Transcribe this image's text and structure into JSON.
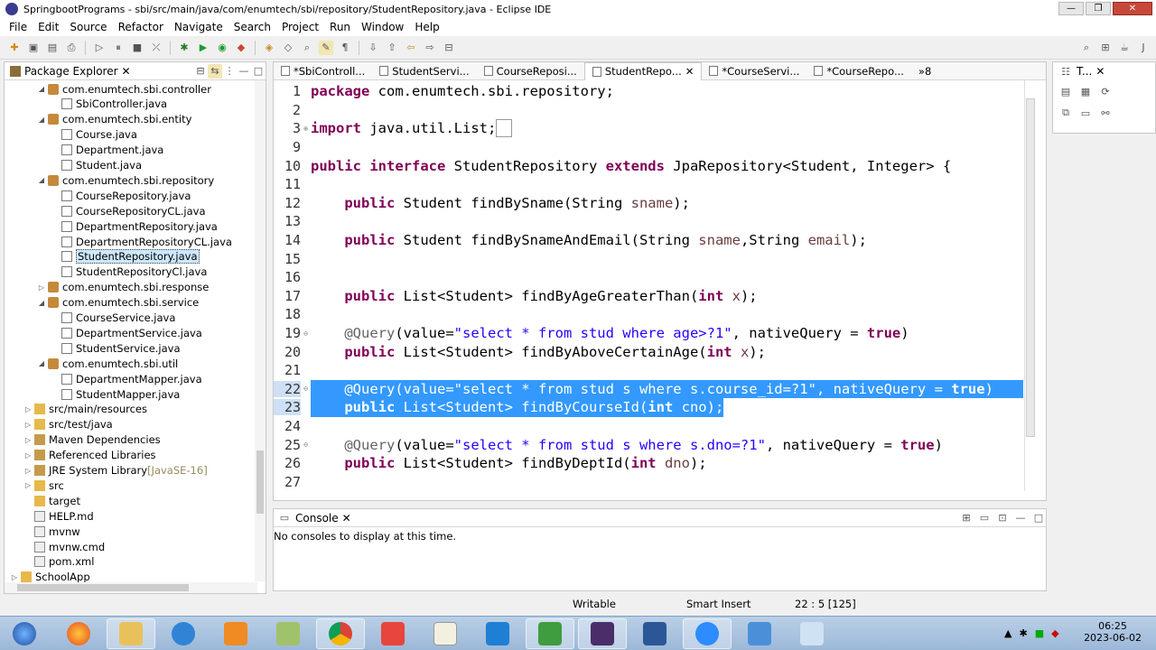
{
  "window": {
    "title": "SpringbootPrograms - sbi/src/main/java/com/enumtech/sbi/repository/StudentRepository.java - Eclipse IDE"
  },
  "menu": [
    "File",
    "Edit",
    "Source",
    "Refactor",
    "Navigate",
    "Search",
    "Project",
    "Run",
    "Window",
    "Help"
  ],
  "package_explorer": {
    "title": "Package Explorer",
    "items": [
      {
        "label": "com.enumtech.sbi.controller",
        "depth": 2,
        "type": "package",
        "expanded": true
      },
      {
        "label": "SbiController.java",
        "depth": 3,
        "type": "java"
      },
      {
        "label": "com.enumtech.sbi.entity",
        "depth": 2,
        "type": "package",
        "expanded": true
      },
      {
        "label": "Course.java",
        "depth": 3,
        "type": "java"
      },
      {
        "label": "Department.java",
        "depth": 3,
        "type": "java"
      },
      {
        "label": "Student.java",
        "depth": 3,
        "type": "java"
      },
      {
        "label": "com.enumtech.sbi.repository",
        "depth": 2,
        "type": "package",
        "expanded": true
      },
      {
        "label": "CourseRepository.java",
        "depth": 3,
        "type": "java"
      },
      {
        "label": "CourseRepositoryCL.java",
        "depth": 3,
        "type": "java"
      },
      {
        "label": "DepartmentRepository.java",
        "depth": 3,
        "type": "java"
      },
      {
        "label": "DepartmentRepositoryCL.java",
        "depth": 3,
        "type": "java"
      },
      {
        "label": "StudentRepository.java",
        "depth": 3,
        "type": "java",
        "selected": true
      },
      {
        "label": "StudentRepositoryCl.java",
        "depth": 3,
        "type": "java"
      },
      {
        "label": "com.enumtech.sbi.response",
        "depth": 2,
        "type": "package",
        "expanded": false
      },
      {
        "label": "com.enumtech.sbi.service",
        "depth": 2,
        "type": "package",
        "expanded": true
      },
      {
        "label": "CourseService.java",
        "depth": 3,
        "type": "java"
      },
      {
        "label": "DepartmentService.java",
        "depth": 3,
        "type": "java"
      },
      {
        "label": "StudentService.java",
        "depth": 3,
        "type": "java"
      },
      {
        "label": "com.enumtech.sbi.util",
        "depth": 2,
        "type": "package",
        "expanded": true
      },
      {
        "label": "DepartmentMapper.java",
        "depth": 3,
        "type": "java"
      },
      {
        "label": "StudentMapper.java",
        "depth": 3,
        "type": "java"
      },
      {
        "label": "src/main/resources",
        "depth": 1,
        "type": "folder",
        "expanded": false
      },
      {
        "label": "src/test/java",
        "depth": 1,
        "type": "folder",
        "expanded": false
      },
      {
        "label": "Maven Dependencies",
        "depth": 1,
        "type": "jar",
        "expanded": false
      },
      {
        "label": "Referenced Libraries",
        "depth": 1,
        "type": "jar",
        "expanded": false
      },
      {
        "label": "JRE System Library",
        "suffix": "[JavaSE-16]",
        "depth": 1,
        "type": "jar",
        "expanded": false
      },
      {
        "label": "src",
        "depth": 1,
        "type": "folder",
        "expanded": false
      },
      {
        "label": "target",
        "depth": 1,
        "type": "folder"
      },
      {
        "label": "HELP.md",
        "depth": 1,
        "type": "file"
      },
      {
        "label": "mvnw",
        "depth": 1,
        "type": "file"
      },
      {
        "label": "mvnw.cmd",
        "depth": 1,
        "type": "file"
      },
      {
        "label": "pom.xml",
        "depth": 1,
        "type": "file"
      },
      {
        "label": "SchoolApp",
        "depth": 0,
        "type": "project",
        "expanded": false
      }
    ]
  },
  "editor_tabs": [
    {
      "label": "*SbiControll..."
    },
    {
      "label": "StudentServi..."
    },
    {
      "label": "CourseReposi..."
    },
    {
      "label": "StudentRepo...",
      "active": true
    },
    {
      "label": "*CourseServi..."
    },
    {
      "label": "*CourseRepo..."
    },
    {
      "label": "»8"
    }
  ],
  "code_lines": [
    {
      "n": "1",
      "html": "<span class=\"kw\">package</span> com.enumtech.sbi.repository;"
    },
    {
      "n": "2",
      "html": ""
    },
    {
      "n": "3",
      "fold": "⊕",
      "html": "<span class=\"kw\">import</span> java.util.List;<span style=\"border:1px solid #999;padding:0 3px\">&nbsp;</span>"
    },
    {
      "n": "9",
      "html": ""
    },
    {
      "n": "10",
      "html": "<span class=\"kw\">public interface</span> StudentRepository <span class=\"kw\">extends</span> JpaRepository&lt;Student, Integer&gt; {"
    },
    {
      "n": "11",
      "html": ""
    },
    {
      "n": "12",
      "html": "    <span class=\"kw\">public</span> Student findBySname(String <span class=\"var\">sname</span>);"
    },
    {
      "n": "13",
      "html": ""
    },
    {
      "n": "14",
      "html": "    <span class=\"kw\">public</span> Student findBySnameAndEmail(String <span class=\"var\">sname</span>,String <span class=\"var\">email</span>);"
    },
    {
      "n": "15",
      "html": ""
    },
    {
      "n": "16",
      "html": ""
    },
    {
      "n": "17",
      "html": "    <span class=\"kw\">public</span> List&lt;Student&gt; findByAgeGreaterThan(<span class=\"kw\">int</span> <span class=\"var\">x</span>);"
    },
    {
      "n": "18",
      "html": ""
    },
    {
      "n": "19",
      "fold": "⊖",
      "html": "    <span class=\"ann\">@Query</span>(value=<span class=\"str\">\"select * from stud where age&gt;?1\"</span>, nativeQuery = <span class=\"kw\">true</span>)"
    },
    {
      "n": "20",
      "html": "    <span class=\"kw\">public</span> List&lt;Student&gt; findByAboveCertainAge(<span class=\"kw\">int</span> <span class=\"var\">x</span>);"
    },
    {
      "n": "21",
      "html": ""
    },
    {
      "n": "22",
      "fold": "⊖",
      "sel": "full",
      "html": "    <span class=\"ann\">@Query</span>(value=<span class=\"str\">\"select * from stud s where s.course_id=?1\"</span>, nativeQuery = <span class=\"kw\">true</span>)"
    },
    {
      "n": "23",
      "sel": "partial",
      "html": "    <span class=\"kw\">public</span> List&lt;Student&gt; findByCourseId(<span class=\"kw\">int</span> <span class=\"var\">cno</span>);"
    },
    {
      "n": "24",
      "html": ""
    },
    {
      "n": "25",
      "fold": "⊖",
      "html": "    <span class=\"ann\">@Query</span>(value=<span class=\"str\">\"select * from stud s where s.dno=?1\"</span>, nativeQuery = <span class=\"kw\">true</span>)"
    },
    {
      "n": "26",
      "html": "    <span class=\"kw\">public</span> List&lt;Student&gt; findByDeptId(<span class=\"kw\">int</span> <span class=\"var\">dno</span>);"
    },
    {
      "n": "27",
      "html": ""
    }
  ],
  "side_view": {
    "title": "T..."
  },
  "console": {
    "title": "Console",
    "message": "No consoles to display at this time."
  },
  "status": {
    "writable": "Writable",
    "insert_mode": "Smart Insert",
    "position": "22 : 5 [125]"
  },
  "clock": {
    "time": "06:25",
    "date": "2023-06-02"
  },
  "colors": {
    "selection": "#3399ff",
    "keyword": "#7f0055",
    "string": "#2a00ff"
  }
}
